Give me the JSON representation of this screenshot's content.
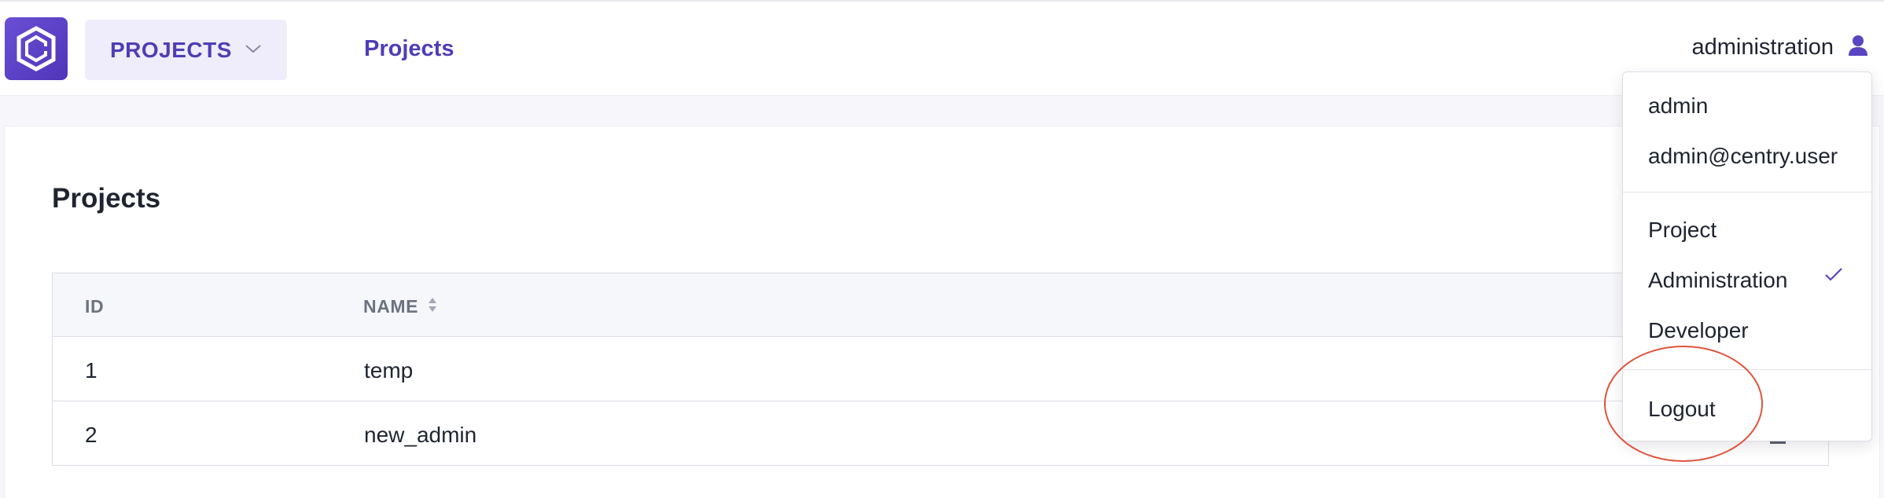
{
  "header": {
    "project_switcher_label": "PROJECTS",
    "nav_link": "Projects",
    "username": "administration"
  },
  "page": {
    "title": "Projects"
  },
  "table": {
    "columns": [
      "ID",
      "NAME"
    ],
    "rows": [
      {
        "id": "1",
        "name": "temp"
      },
      {
        "id": "2",
        "name": "new_admin"
      }
    ]
  },
  "user_dropdown": {
    "name": "admin",
    "email": "admin@centry.user",
    "roles": [
      "Project",
      "Administration",
      "Developer"
    ],
    "selected_role": "Administration",
    "logout_label": "Logout"
  },
  "colors": {
    "accent": "#4f3db6",
    "annotation": "#e0543c"
  },
  "icons": {
    "logo": "centry-logo-icon",
    "chevron": "chevron-down-icon",
    "user": "user-icon",
    "sort": "sort-icon",
    "check": "check-icon"
  }
}
